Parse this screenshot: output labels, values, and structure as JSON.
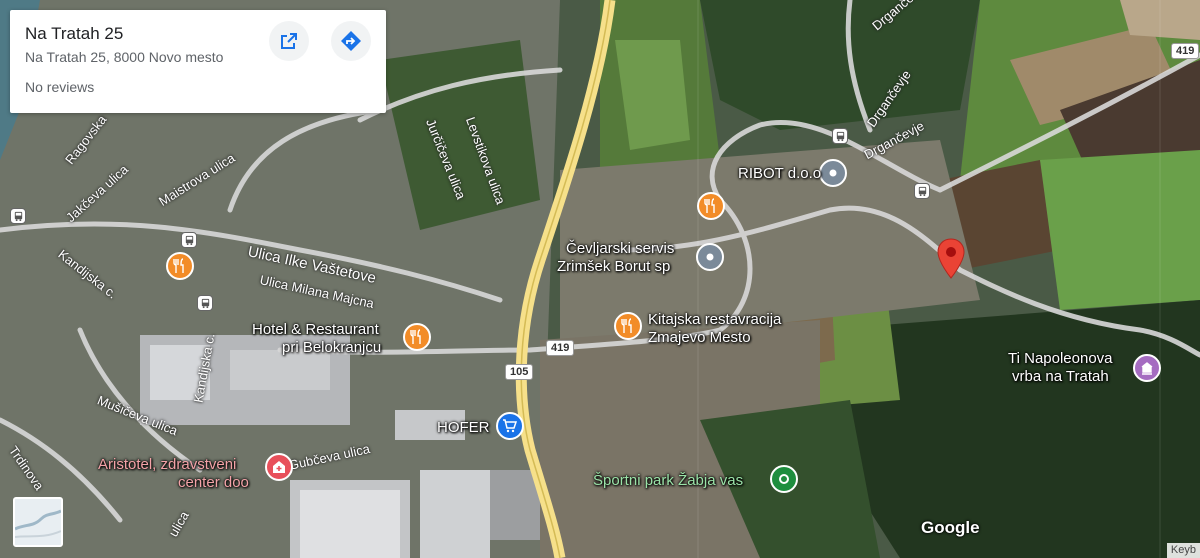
{
  "place_card": {
    "title": "Na Tratah 25",
    "address": "Na Tratah 25, 8000 Novo mesto",
    "reviews": "No reviews",
    "open_icon": "open-in-new-icon",
    "directions_icon": "directions-icon"
  },
  "map_labels": {
    "ribot": "RIBOT d.o.o",
    "cevljarski": "Čevljarski servis",
    "cevljarski2": "Zrimšek Borut sp",
    "hotel1": "Hotel & Restaurant",
    "hotel2": "pri Belokranjcu",
    "kitajska1": "Kitajska restavracija",
    "kitajska2": "Zmajevo Mesto",
    "napoleon1": "Ti Napoleonova",
    "napoleon2": "vrba na Tratah",
    "hofer": "HOFER",
    "aristotel1": "Aristotel, zdravstveni",
    "aristotel2": "center doo",
    "sportni": "Športni park Žabja vas"
  },
  "streets": {
    "ulica_ilke": "Ulica Ilke Vaštetove",
    "ulica_milana": "Ulica Milana Majcna",
    "kandijska1": "Kandijska c.",
    "kandijska2": "Kandijska c.",
    "musiceva": "Mušičeva ulica",
    "trdinova": "Trdinova",
    "gubceva": "Gubčeva ulica",
    "jakceva": "Jakčeva ulica",
    "ragovska": "Ragovska",
    "maistrova": "Maistrova ulica",
    "jurciceva": "Jurčičeva ulica",
    "levstikova": "Levstikova ulica",
    "drgancevje1": "Drgančevje",
    "drgancevje2": "Drgančevje",
    "drgancevje3": "Drgančevje",
    "ulica_bottom": "ulica"
  },
  "road_shields": {
    "r419a": "419",
    "r419b": "419",
    "r105": "105"
  },
  "controls": {
    "logo": "Google",
    "keyboard": "Keyb"
  },
  "colors": {
    "pin": "#ea4335",
    "restaurant": "#f28c28",
    "generic_poi": "#7b8a99",
    "shopping": "#1a73e8",
    "medical": "#e8505b",
    "park": "#1e8e3e",
    "historic": "#a56cc1",
    "highway": "#f6e08a",
    "road": "#cfcfcf"
  }
}
